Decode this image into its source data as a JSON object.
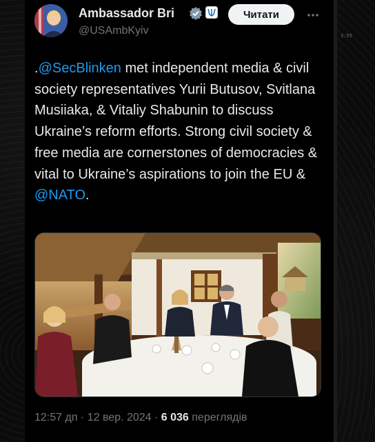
{
  "author": {
    "name": "Ambassador Bri",
    "handle": "@USAmbKyiv"
  },
  "follow_button_label": "Читати",
  "icons": {
    "verified": "verified-badge-icon",
    "affiliation": "ukraine-emblem-icon",
    "more": "more-options-icon"
  },
  "tweet": {
    "prefix": ".",
    "mention_1": "@SecBlinken",
    "body": " met independent media & civil society representatives Yurii Butusov, Svitlana Musiiaka, & Vitaliy Shabunin to discuss Ukraine’s reform efforts. Strong civil society & free media are cornerstones of democracies & vital to Ukraine’s aspirations to join the EU & ",
    "mention_2": "@NATO",
    "suffix": "."
  },
  "meta": {
    "time": "12:57 дп",
    "separator_1": " · ",
    "date": "12 вер. 2024",
    "separator_2": " · ",
    "views_count": "6 036",
    "views_label": " переглядів"
  },
  "side_label": "3:55",
  "colors": {
    "accent": "#1d9bf0",
    "text": "#e7e9ea",
    "muted": "#71767b",
    "background": "#000000"
  }
}
